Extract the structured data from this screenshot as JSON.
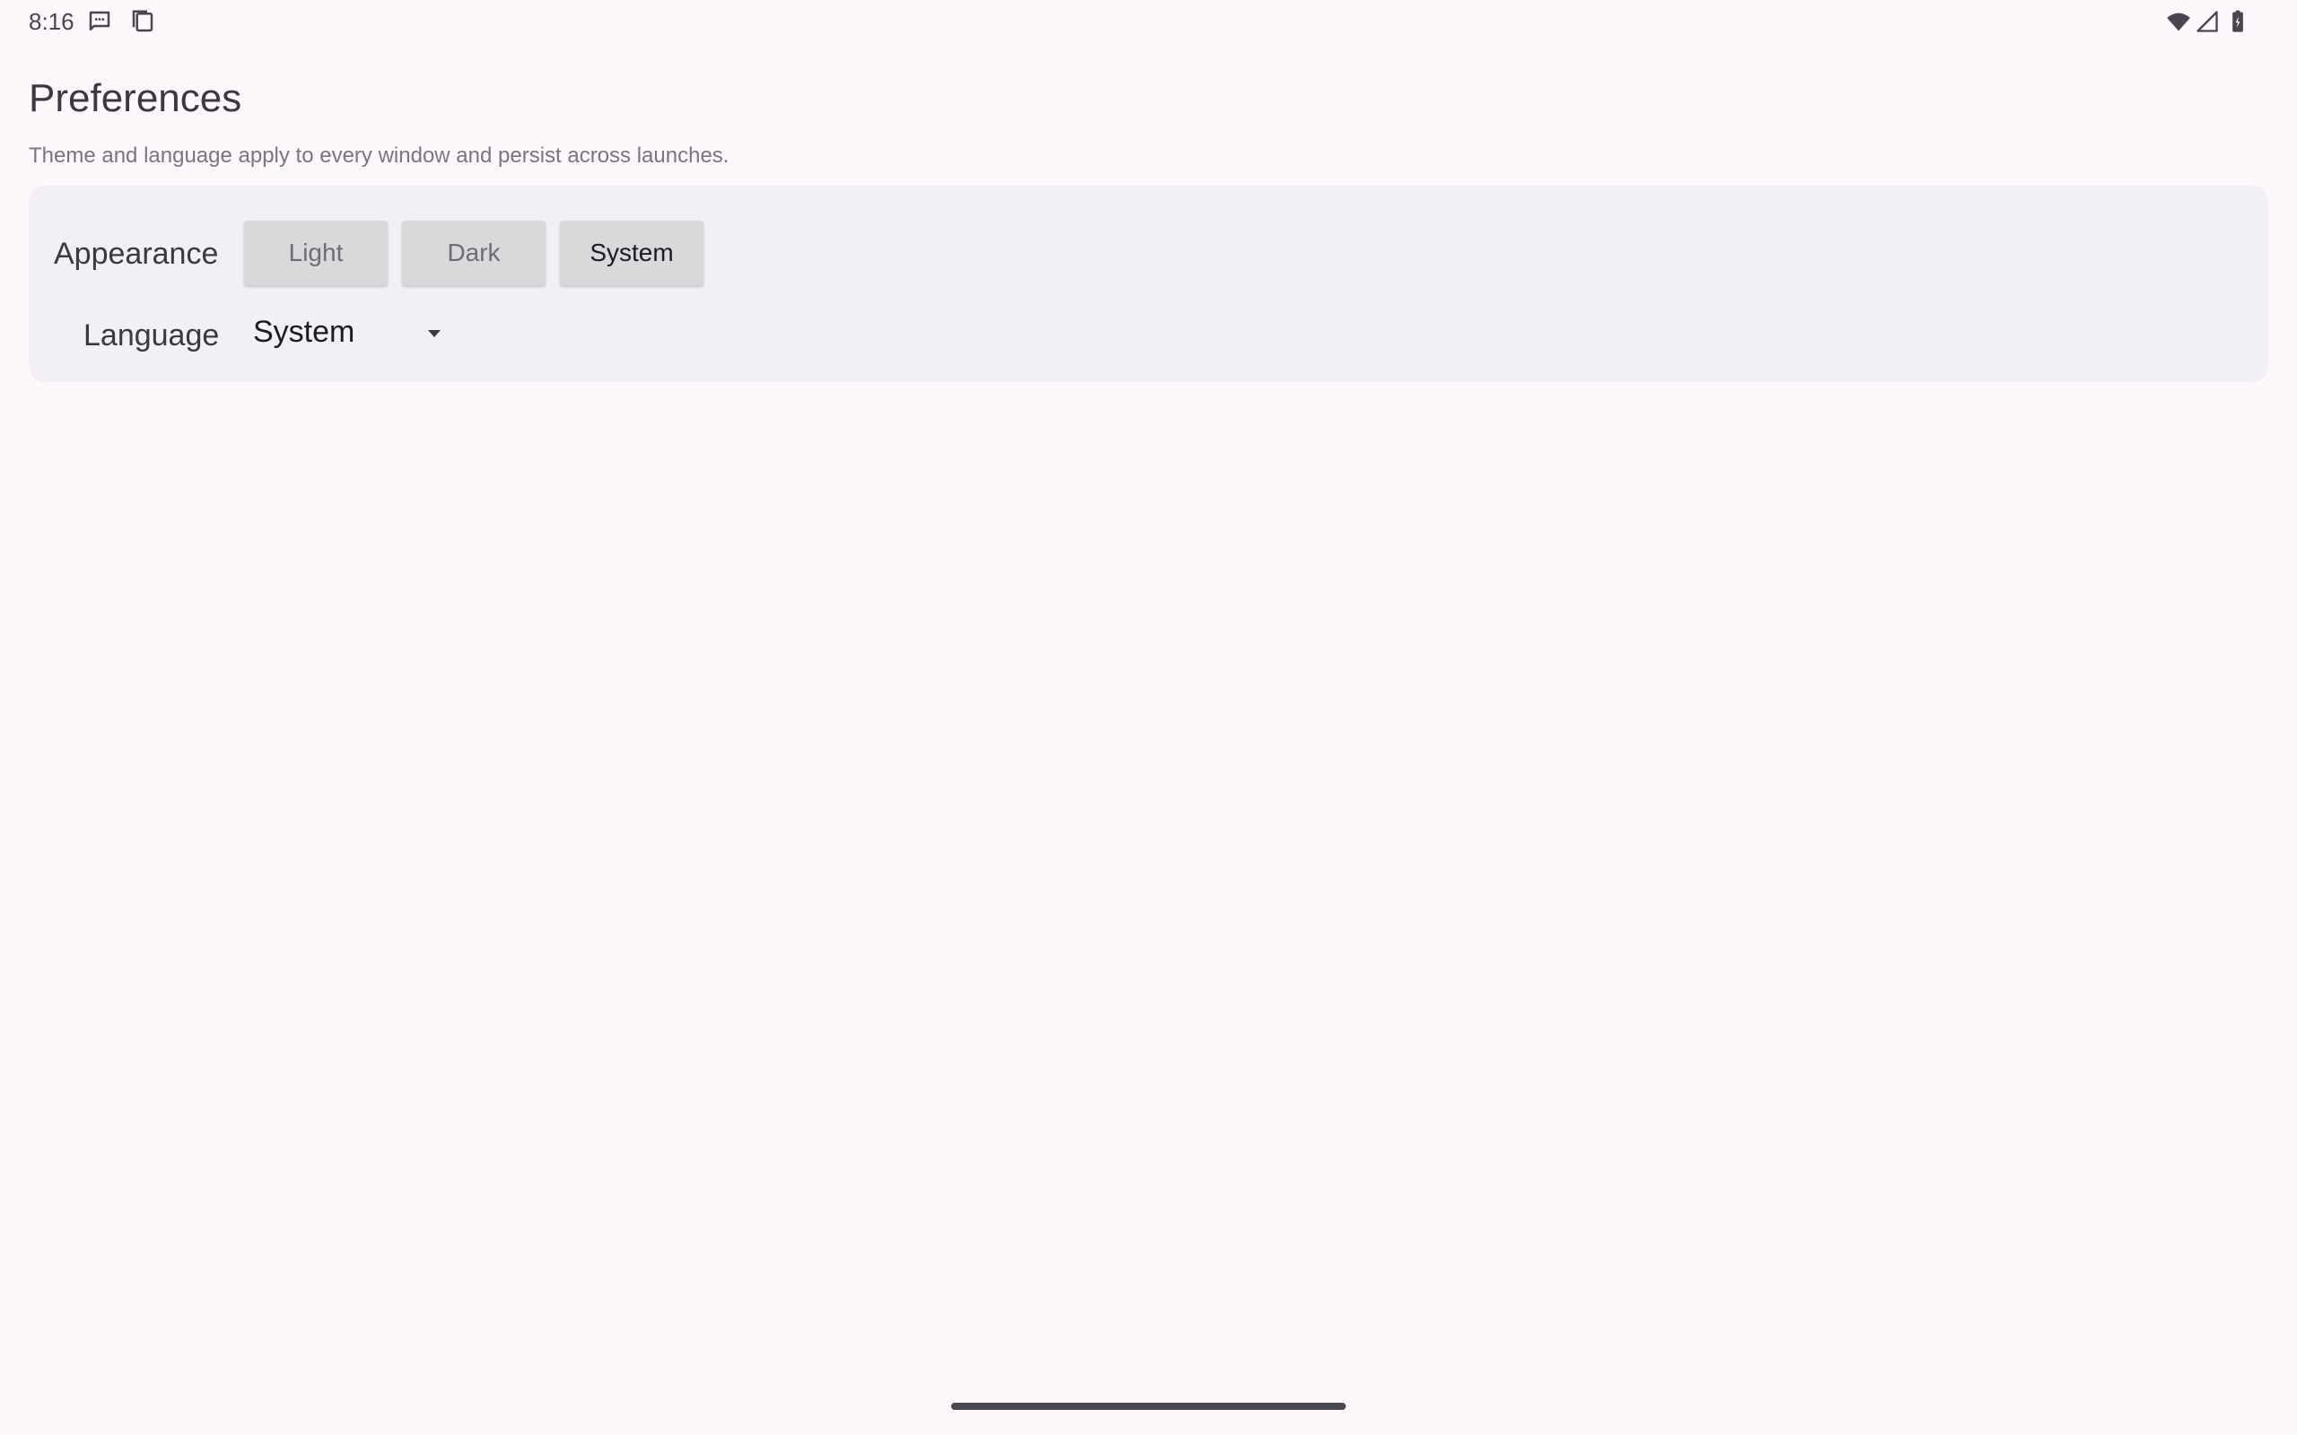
{
  "status_bar": {
    "time": "8:16",
    "left_icons": [
      "message-icon",
      "copy-icon"
    ],
    "right_icons": [
      "wifi-icon",
      "signal-icon",
      "battery-icon"
    ]
  },
  "header": {
    "title": "Preferences",
    "subtitle": "Theme and language apply to every window and persist across launches."
  },
  "settings": {
    "appearance": {
      "label": "Appearance",
      "options": [
        "Light",
        "Dark",
        "System"
      ],
      "selected": "System"
    },
    "language": {
      "label": "Language",
      "value": "System"
    }
  },
  "colors": {
    "background": "#fef7fc",
    "card": "#f2eff5",
    "button": "#d9d9dc"
  }
}
